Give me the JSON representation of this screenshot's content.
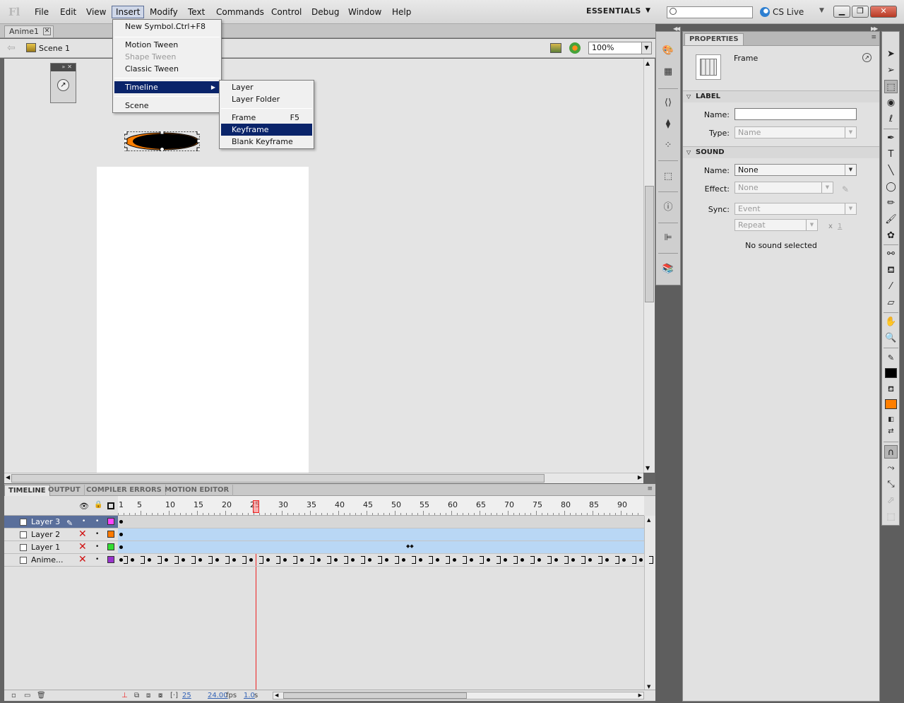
{
  "app": {
    "logo": "Fl"
  },
  "menubar": {
    "items": [
      "File",
      "Edit",
      "View",
      "Insert",
      "Modify",
      "Text",
      "Commands",
      "Control",
      "Debug",
      "Window",
      "Help"
    ],
    "active": "Insert",
    "workspace": "ESSENTIALS",
    "search_value": "",
    "cs_live": "CS Live"
  },
  "document": {
    "tab": "Anime1",
    "scene": "Scene 1",
    "zoom": "100%"
  },
  "insert_menu": {
    "new_symbol": "New Symbol...",
    "new_symbol_shortcut": "Ctrl+F8",
    "motion_tween": "Motion Tween",
    "shape_tween": "Shape Tween",
    "classic_tween": "Classic Tween",
    "timeline": "Timeline",
    "scene": "Scene"
  },
  "timeline_submenu": {
    "layer": "Layer",
    "layer_folder": "Layer Folder",
    "frame": "Frame",
    "frame_shortcut": "F5",
    "keyframe": "Keyframe",
    "blank_keyframe": "Blank Keyframe",
    "highlighted": "Keyframe"
  },
  "timeline": {
    "tabs": [
      "TIMELINE",
      "OUTPUT",
      "COMPILER ERRORS",
      "MOTION EDITOR"
    ],
    "ruler": [
      "1",
      "5",
      "10",
      "15",
      "20",
      "25",
      "30",
      "35",
      "40",
      "45",
      "50",
      "55",
      "60",
      "65",
      "70",
      "75",
      "80",
      "85",
      "90"
    ],
    "current_frame_number": 25,
    "layers": [
      {
        "name": "Layer 3",
        "color": "#ff44ff",
        "selected": true
      },
      {
        "name": "Layer 2",
        "color": "#ff7a00",
        "selected": false
      },
      {
        "name": "Layer 1",
        "color": "#33dd33",
        "selected": false
      },
      {
        "name": "Anime...",
        "color": "#9933cc",
        "selected": false
      }
    ],
    "footer": {
      "current_frame": "25",
      "fps": "24.00",
      "fps_unit": "fps",
      "time": "1.0",
      "time_unit": "s"
    }
  },
  "properties": {
    "tab": "PROPERTIES",
    "object_type": "Frame",
    "label_section": "LABEL",
    "label_name_label": "Name:",
    "label_name_value": "",
    "label_type_label": "Type:",
    "label_type_value": "Name",
    "sound_section": "SOUND",
    "sound_name_label": "Name:",
    "sound_name_value": "None",
    "effect_label": "Effect:",
    "effect_value": "None",
    "sync_label": "Sync:",
    "sync_value": "Event",
    "repeat_value": "Repeat",
    "repeat_x": "x",
    "repeat_count": "1",
    "status": "No sound selected"
  },
  "colors": {
    "stroke": "#000000",
    "fill": "#ff7f00",
    "selection_highlight": "#0a246a"
  }
}
